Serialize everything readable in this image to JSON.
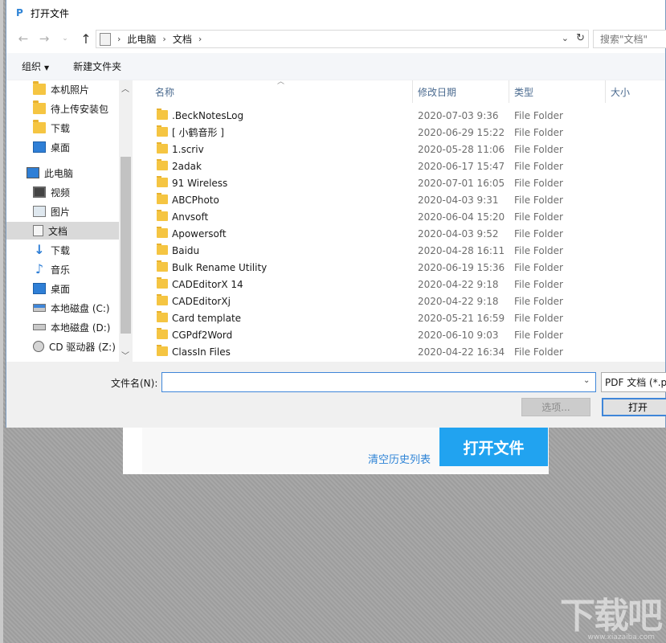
{
  "dialog": {
    "title": "打开文件",
    "app_icon_glyph": "P"
  },
  "nav": {
    "back_icon": "←",
    "forward_icon": "→",
    "up_icon": "↑",
    "breadcrumb": [
      "此电脑",
      "文档"
    ],
    "search_placeholder": "搜索\"文档\""
  },
  "toolbar": {
    "organize_label": "组织",
    "new_folder_label": "新建文件夹"
  },
  "tree": {
    "items": [
      {
        "label": "本机照片",
        "icon": "folder-icon"
      },
      {
        "label": "待上传安装包",
        "icon": "folder-icon"
      },
      {
        "label": "下载",
        "icon": "folder-icon"
      },
      {
        "label": "桌面",
        "icon": "desktop-icon"
      },
      {
        "label": "此电脑",
        "icon": "pc-icon"
      },
      {
        "label": "视频",
        "icon": "video-icon"
      },
      {
        "label": "图片",
        "icon": "picture-icon"
      },
      {
        "label": "文档",
        "icon": "document-icon",
        "selected": true
      },
      {
        "label": "下载",
        "icon": "download-icon"
      },
      {
        "label": "音乐",
        "icon": "music-icon"
      },
      {
        "label": "桌面",
        "icon": "desktop-icon"
      },
      {
        "label": "本地磁盘 (C:)",
        "icon": "drive-icon"
      },
      {
        "label": "本地磁盘 (D:)",
        "icon": "drive-icon"
      },
      {
        "label": "CD 驱动器 (Z:)",
        "icon": "cd-drive-icon"
      }
    ]
  },
  "columns": {
    "name": "名称",
    "modified": "修改日期",
    "type": "类型",
    "size": "大小"
  },
  "files": [
    {
      "name": ".BeckNotesLog",
      "modified": "2020-07-03 9:36",
      "type": "File Folder"
    },
    {
      "name": "[ 小鹤音形 ]",
      "modified": "2020-06-29 15:22",
      "type": "File Folder"
    },
    {
      "name": "1.scriv",
      "modified": "2020-05-28 11:06",
      "type": "File Folder"
    },
    {
      "name": "2adak",
      "modified": "2020-06-17 15:47",
      "type": "File Folder"
    },
    {
      "name": "91 Wireless",
      "modified": "2020-07-01 16:05",
      "type": "File Folder"
    },
    {
      "name": "ABCPhoto",
      "modified": "2020-04-03 9:31",
      "type": "File Folder"
    },
    {
      "name": "Anvsoft",
      "modified": "2020-06-04 15:20",
      "type": "File Folder"
    },
    {
      "name": "Apowersoft",
      "modified": "2020-04-03 9:52",
      "type": "File Folder"
    },
    {
      "name": "Baidu",
      "modified": "2020-04-28 16:11",
      "type": "File Folder"
    },
    {
      "name": "Bulk Rename Utility",
      "modified": "2020-06-19 15:36",
      "type": "File Folder"
    },
    {
      "name": "CADEditorX 14",
      "modified": "2020-04-22 9:18",
      "type": "File Folder"
    },
    {
      "name": "CADEditorXj",
      "modified": "2020-04-22 9:18",
      "type": "File Folder"
    },
    {
      "name": "Card template",
      "modified": "2020-05-21 16:59",
      "type": "File Folder"
    },
    {
      "name": "CGPdf2Word",
      "modified": "2020-06-10 9:03",
      "type": "File Folder"
    },
    {
      "name": "ClassIn Files",
      "modified": "2020-04-22 16:34",
      "type": "File Folder"
    }
  ],
  "footer": {
    "filename_label": "文件名(N):",
    "filename_value": "",
    "filetype_value": "PDF 文档 (*.pdf)",
    "options_label": "选项...",
    "open_label": "打开"
  },
  "background_app": {
    "clear_history_label": "清空历史列表",
    "open_file_label": "打开文件",
    "watermark_text": "下载吧",
    "watermark_url": "www.xiazaiba.com"
  }
}
